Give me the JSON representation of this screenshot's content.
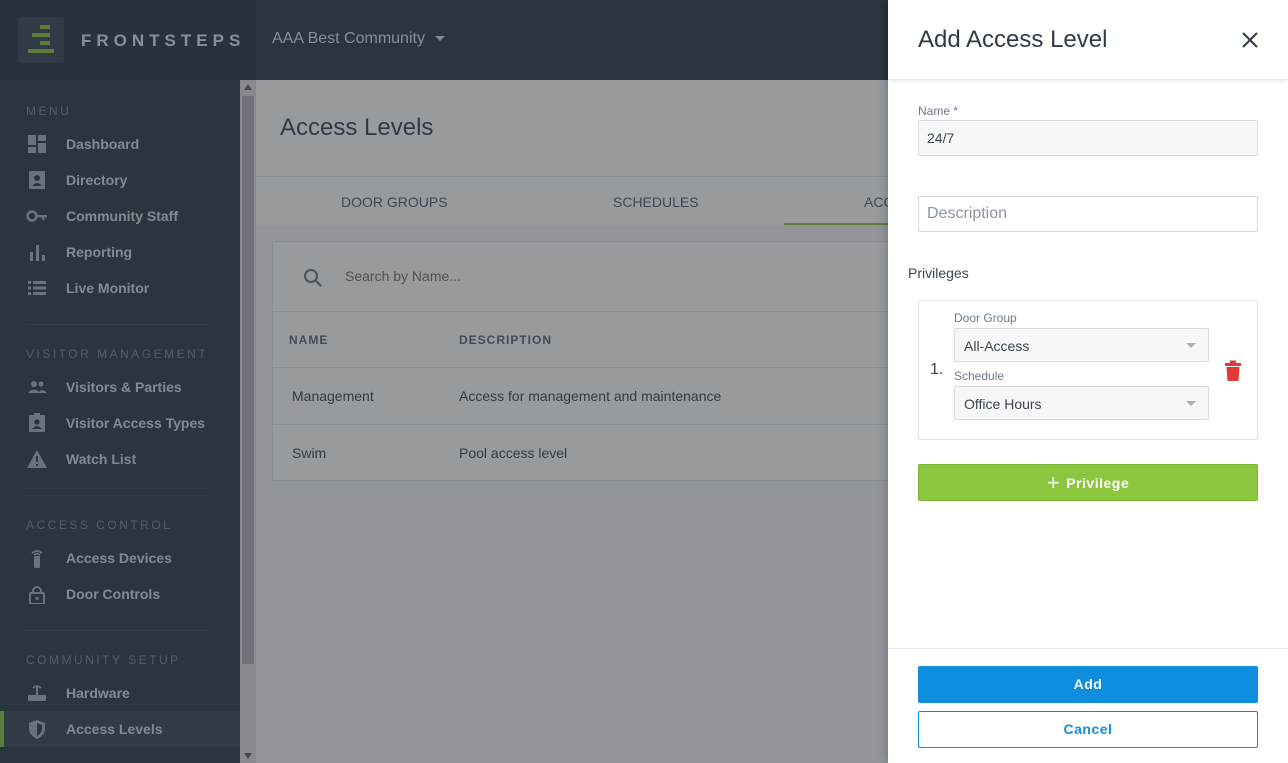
{
  "header": {
    "logo_text": "FRONTSTEPS",
    "community": "AAA Best Community"
  },
  "sidebar": {
    "sections": [
      {
        "title": "MENU",
        "items": [
          {
            "label": "Dashboard",
            "icon": "dashboard-icon"
          },
          {
            "label": "Directory",
            "icon": "contact-card-icon"
          },
          {
            "label": "Community Staff",
            "icon": "key-icon"
          },
          {
            "label": "Reporting",
            "icon": "bar-chart-icon"
          },
          {
            "label": "Live Monitor",
            "icon": "list-icon"
          }
        ]
      },
      {
        "title": "VISITOR MANAGEMENT",
        "items": [
          {
            "label": "Visitors & Parties",
            "icon": "people-icon"
          },
          {
            "label": "Visitor Access Types",
            "icon": "badge-icon"
          },
          {
            "label": "Watch List",
            "icon": "warning-icon"
          }
        ]
      },
      {
        "title": "ACCESS CONTROL",
        "items": [
          {
            "label": "Access Devices",
            "icon": "remote-icon"
          },
          {
            "label": "Door Controls",
            "icon": "lock-icon"
          }
        ]
      },
      {
        "title": "COMMUNITY SETUP",
        "items": [
          {
            "label": "Hardware",
            "icon": "router-icon"
          },
          {
            "label": "Access Levels",
            "icon": "shield-icon",
            "active": true
          }
        ]
      }
    ]
  },
  "main": {
    "title": "Access Levels",
    "tabs": [
      "DOOR GROUPS",
      "SCHEDULES",
      "ACC"
    ],
    "search_placeholder": "Search by Name...",
    "columns": [
      "NAME",
      "DESCRIPTION"
    ],
    "rows": [
      {
        "name": "Management",
        "description": "Access for management and maintenance"
      },
      {
        "name": "Swim",
        "description": "Pool access level"
      }
    ]
  },
  "drawer": {
    "title": "Add Access Level",
    "name_label": "Name *",
    "name_value": "24/7",
    "description_placeholder": "Description",
    "privileges_title": "Privileges",
    "privilege": {
      "number": "1.",
      "door_group_label": "Door Group",
      "door_group_value": "All-Access",
      "schedule_label": "Schedule",
      "schedule_value": "Office Hours"
    },
    "add_privilege_label": "Privilege",
    "add_label": "Add",
    "cancel_label": "Cancel"
  },
  "colors": {
    "accent_green": "#8cc63f",
    "primary_blue": "#0f8ee0",
    "danger_red": "#e53935",
    "nav_bg": "#2f3c4c"
  }
}
